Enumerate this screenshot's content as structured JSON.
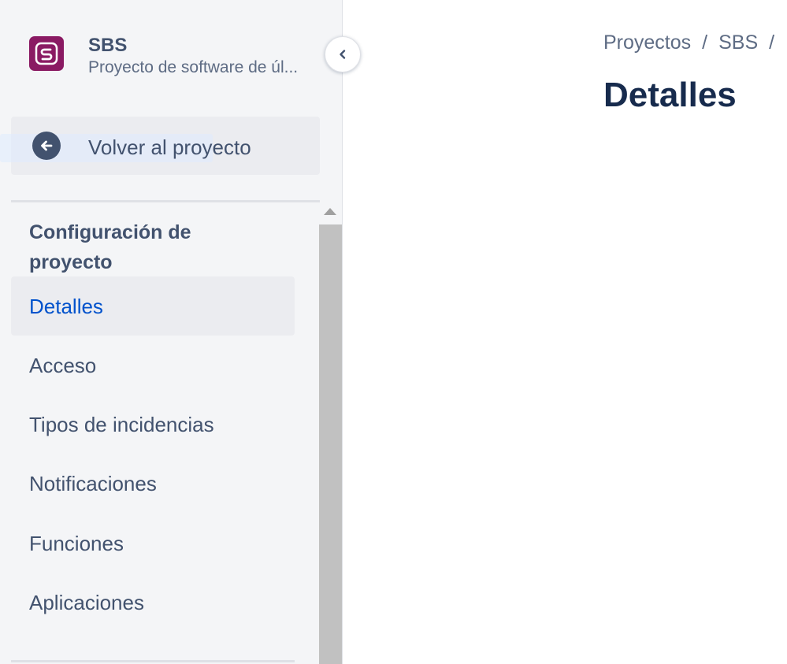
{
  "project": {
    "name": "SBS",
    "description": "Proyecto de software de úl..."
  },
  "sidebar": {
    "back_label": "Volver al proyecto",
    "section_heading": "Configuración de proyecto",
    "items": [
      {
        "label": "Detalles",
        "active": true
      },
      {
        "label": "Acceso"
      },
      {
        "label": "Tipos de incidencias"
      },
      {
        "label": "Notificaciones"
      },
      {
        "label": "Funciones"
      },
      {
        "label": "Aplicaciones"
      }
    ]
  },
  "breadcrumb": {
    "items": [
      "Proyectos",
      "SBS"
    ],
    "separator": "/"
  },
  "page": {
    "title": "Detalles"
  },
  "icons": {
    "project_avatar": "project-logo-icon",
    "collapse": "chevron-left-icon",
    "back": "arrow-left-icon"
  },
  "colors": {
    "avatar_bg": "#8a1a63",
    "active_text": "#0052cc",
    "sidebar_bg": "#f4f5f7"
  }
}
